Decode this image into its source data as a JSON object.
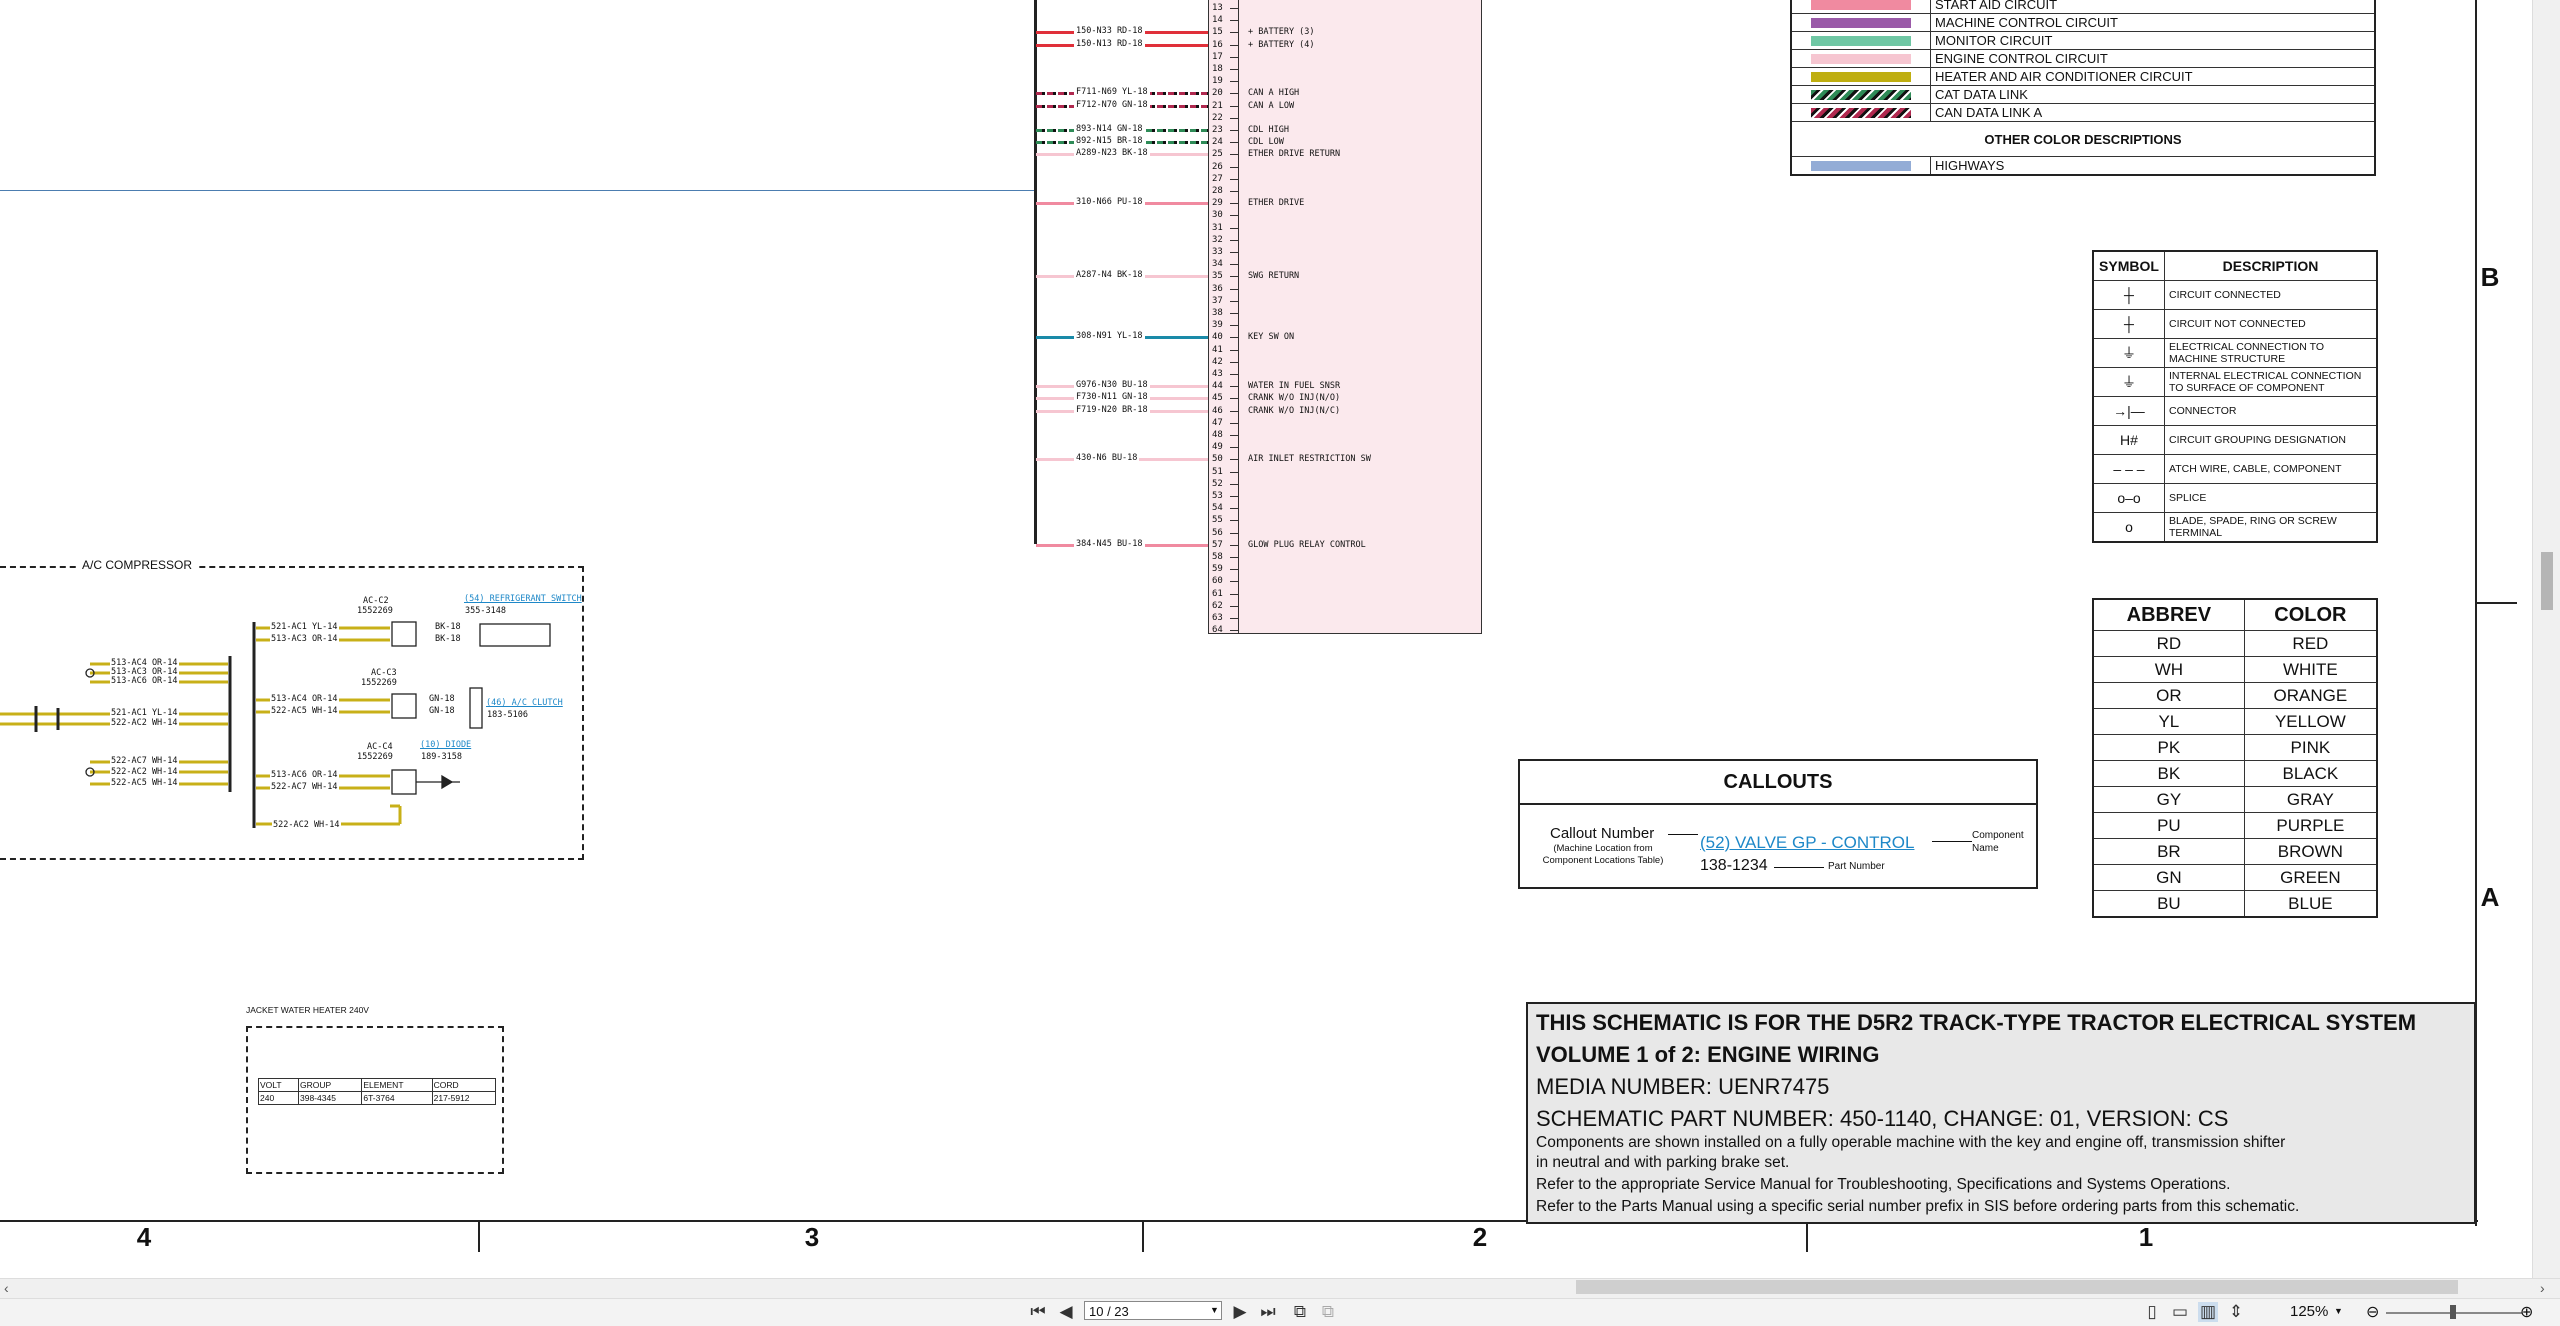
{
  "zones": {
    "letters": [
      "B",
      "A"
    ],
    "columns": [
      "4",
      "3",
      "2",
      "1"
    ]
  },
  "color_legend": {
    "rows": [
      {
        "label": "START AID CIRCUIT",
        "color": "#f08aa0"
      },
      {
        "label": "MACHINE CONTROL CIRCUIT",
        "color": "#9a5aa8"
      },
      {
        "label": "MONITOR CIRCUIT",
        "color": "#6fc7a4"
      },
      {
        "label": "ENGINE CONTROL CIRCUIT",
        "color": "#f6c6d1"
      },
      {
        "label": "HEATER AND AIR CONDITIONER CIRCUIT",
        "color": "#bfae10"
      },
      {
        "label": "CAT DATA LINK",
        "color": "#2e8b57"
      },
      {
        "label": "CAN DATA LINK A",
        "color": "#b0294f"
      }
    ],
    "other_title": "OTHER COLOR DESCRIPTIONS",
    "other_rows": [
      {
        "label": "HIGHWAYS",
        "color": "#93acd6"
      }
    ]
  },
  "symbol_table": {
    "headers": [
      "SYMBOL",
      "DESCRIPTION"
    ],
    "rows": [
      {
        "icon": "circuit-connected-icon",
        "glyph": "┼",
        "text": "CIRCUIT CONNECTED"
      },
      {
        "icon": "circuit-not-connected-icon",
        "glyph": "┼",
        "text": "CIRCUIT NOT CONNECTED"
      },
      {
        "icon": "ground-icon",
        "glyph": "⏚",
        "text": "ELECTRICAL CONNECTION TO MACHINE STRUCTURE"
      },
      {
        "icon": "internal-ground-icon",
        "glyph": "⏚",
        "text": "INTERNAL ELECTRICAL CONNECTION TO SURFACE OF COMPONENT"
      },
      {
        "icon": "connector-icon",
        "glyph": "→|—",
        "text": "CONNECTOR"
      },
      {
        "icon": "circuit-group-icon",
        "glyph": "H#",
        "text": "CIRCUIT GROUPING DESIGNATION"
      },
      {
        "icon": "dashed-line-icon",
        "glyph": "– – –",
        "text": "ATCH WIRE, CABLE, COMPONENT"
      },
      {
        "icon": "splice-icon",
        "glyph": "o–o",
        "text": "SPLICE"
      },
      {
        "icon": "terminal-icon",
        "glyph": "o",
        "text": "BLADE, SPADE, RING OR SCREW TERMINAL"
      }
    ]
  },
  "abbrev_table": {
    "headers": [
      "ABBREV",
      "COLOR"
    ],
    "rows": [
      [
        "RD",
        "RED"
      ],
      [
        "WH",
        "WHITE"
      ],
      [
        "OR",
        "ORANGE"
      ],
      [
        "YL",
        "YELLOW"
      ],
      [
        "PK",
        "PINK"
      ],
      [
        "BK",
        "BLACK"
      ],
      [
        "GY",
        "GRAY"
      ],
      [
        "PU",
        "PURPLE"
      ],
      [
        "BR",
        "BROWN"
      ],
      [
        "GN",
        "GREEN"
      ],
      [
        "BU",
        "BLUE"
      ]
    ]
  },
  "callouts": {
    "title": "CALLOUTS",
    "callout_number": "Callout Number",
    "callout_sub": "(Machine Location from Component Locations Table)",
    "example_link": "(52) VALVE GP - CONTROL",
    "example_part": "138-1234",
    "component_name": "Component Name",
    "part_number": "Part Number"
  },
  "title_block": {
    "line1": "THIS SCHEMATIC IS FOR THE D5R2 TRACK-TYPE TRACTOR ELECTRICAL SYSTEM",
    "line2": "VOLUME 1 of 2: ENGINE WIRING",
    "line3": "MEDIA NUMBER: UENR7475",
    "line4": "SCHEMATIC PART NUMBER: 450-1140, CHANGE: 01, VERSION: CS",
    "line5": "Components are shown installed on a fully operable machine with the key and engine off, transmission shifter",
    "line6": "in neutral and with parking brake set.",
    "line7": "Refer to the appropriate Service Manual for Troubleshooting, Specifications and Systems Operations.",
    "line8": "Refer to the Parts Manual using a specific serial number prefix in SIS before ordering parts from this schematic."
  },
  "connector": {
    "pins": [
      "13",
      "14",
      "15",
      "16",
      "17",
      "18",
      "19",
      "20",
      "21",
      "22",
      "23",
      "24",
      "25",
      "26",
      "27",
      "28",
      "29",
      "30",
      "31",
      "32",
      "33",
      "34",
      "35",
      "36",
      "37",
      "38",
      "39",
      "40",
      "41",
      "42",
      "43",
      "44",
      "45",
      "46",
      "47",
      "48",
      "49",
      "50",
      "51",
      "52",
      "53",
      "54",
      "55",
      "56",
      "57",
      "58",
      "59",
      "60",
      "61",
      "62",
      "63",
      "64"
    ],
    "pin_labels": [
      {
        "pin": "15",
        "text": "+ BATTERY (3)"
      },
      {
        "pin": "16",
        "text": "+ BATTERY (4)"
      },
      {
        "pin": "20",
        "text": "CAN A HIGH"
      },
      {
        "pin": "21",
        "text": "CAN A LOW"
      },
      {
        "pin": "23",
        "text": "CDL HIGH"
      },
      {
        "pin": "24",
        "text": "CDL LOW"
      },
      {
        "pin": "25",
        "text": "ETHER DRIVE RETURN"
      },
      {
        "pin": "29",
        "text": "ETHER DRIVE"
      },
      {
        "pin": "35",
        "text": "SWG RETURN"
      },
      {
        "pin": "40",
        "text": "KEY SW ON"
      },
      {
        "pin": "44",
        "text": "WATER IN FUEL SNSR"
      },
      {
        "pin": "45",
        "text": "CRANK W/O INJ(N/O)"
      },
      {
        "pin": "46",
        "text": "CRANK W/O INJ(N/C)"
      },
      {
        "pin": "50",
        "text": "AIR INLET RESTRICTION SW"
      },
      {
        "pin": "57",
        "text": "GLOW PLUG RELAY CONTROL"
      }
    ],
    "wires": [
      {
        "pin": "15",
        "text": "150-N33 RD-18",
        "color": "#e0303a",
        "style": "solid"
      },
      {
        "pin": "16",
        "text": "150-N13 RD-18",
        "color": "#e0303a",
        "style": "solid"
      },
      {
        "pin": "20",
        "text": "F711-N69 YL-18",
        "color": "#b0294f",
        "style": "dash"
      },
      {
        "pin": "21",
        "text": "F712-N70 GN-18",
        "color": "#b0294f",
        "style": "dash"
      },
      {
        "pin": "23",
        "text": "893-N14 GN-18",
        "color": "#2e8b57",
        "style": "dash"
      },
      {
        "pin": "24",
        "text": "892-N15 BR-18",
        "color": "#2e8b57",
        "style": "dash"
      },
      {
        "pin": "25",
        "text": "A289-N23 BK-18",
        "color": "#f6c6d1",
        "style": "solid"
      },
      {
        "pin": "29",
        "text": "310-N66 PU-18",
        "color": "#f08aa0",
        "style": "solid"
      },
      {
        "pin": "35",
        "text": "A287-N4 BK-18",
        "color": "#f6c6d1",
        "style": "solid"
      },
      {
        "pin": "40",
        "text": "308-N91 YL-18",
        "color": "#1a8aa8",
        "style": "solid"
      },
      {
        "pin": "44",
        "text": "G976-N30 BU-18",
        "color": "#f6c6d1",
        "style": "solid"
      },
      {
        "pin": "45",
        "text": "F730-N11 GN-18",
        "color": "#f6c6d1",
        "style": "solid"
      },
      {
        "pin": "46",
        "text": "F719-N20 BR-18",
        "color": "#f6c6d1",
        "style": "solid"
      },
      {
        "pin": "50",
        "text": "430-N6 BU-18",
        "color": "#f6c6d1",
        "style": "solid"
      },
      {
        "pin": "57",
        "text": "384-N45 BU-18",
        "color": "#f08aa0",
        "style": "solid"
      }
    ]
  },
  "ac_compressor": {
    "title": "A/C COMPRESSOR",
    "left_wires_top": [
      "513-AC4 OR-14",
      "513-AC3 OR-14",
      "513-AC6 OR-14"
    ],
    "left_wires_mid": [
      "521-AC1 YL-14",
      "522-AC2 WH-14"
    ],
    "left_wires_bot": [
      "522-AC7 WH-14",
      "522-AC2 WH-14",
      "522-AC5 WH-14"
    ],
    "c2": {
      "name": "AC-C2",
      "part": "1552269",
      "wires": [
        "521-AC1 YL-14",
        "513-AC3 OR-14"
      ],
      "right": [
        "BK-18",
        "BK-18"
      ]
    },
    "c3": {
      "name": "AC-C3",
      "part": "1552269",
      "wires": [
        "513-AC4 OR-14",
        "522-AC5 WH-14"
      ],
      "right": [
        "GN-18",
        "GN-18"
      ]
    },
    "c4": {
      "name": "AC-C4",
      "part": "1552269",
      "wires": [
        "513-AC6 OR-14",
        "522-AC7 WH-14"
      ]
    },
    "bottom_wire": "522-AC2 WH-14",
    "refrig_switch": "(54) REFRIGERANT SWITCH",
    "refrig_part": "355-3148",
    "clutch": "(46) A/C CLUTCH",
    "clutch_part": "183-5106",
    "diode": "(10) DIODE",
    "diode_part": "189-3158"
  },
  "heater": {
    "title": "JACKET WATER HEATER 240V",
    "headers": [
      "VOLT",
      "GROUP",
      "ELEMENT",
      "CORD"
    ],
    "row": [
      "240",
      "398-4345",
      "6T-3764",
      "217-5912"
    ]
  },
  "toolbar": {
    "page": "10 / 23",
    "zoom": "125%"
  }
}
